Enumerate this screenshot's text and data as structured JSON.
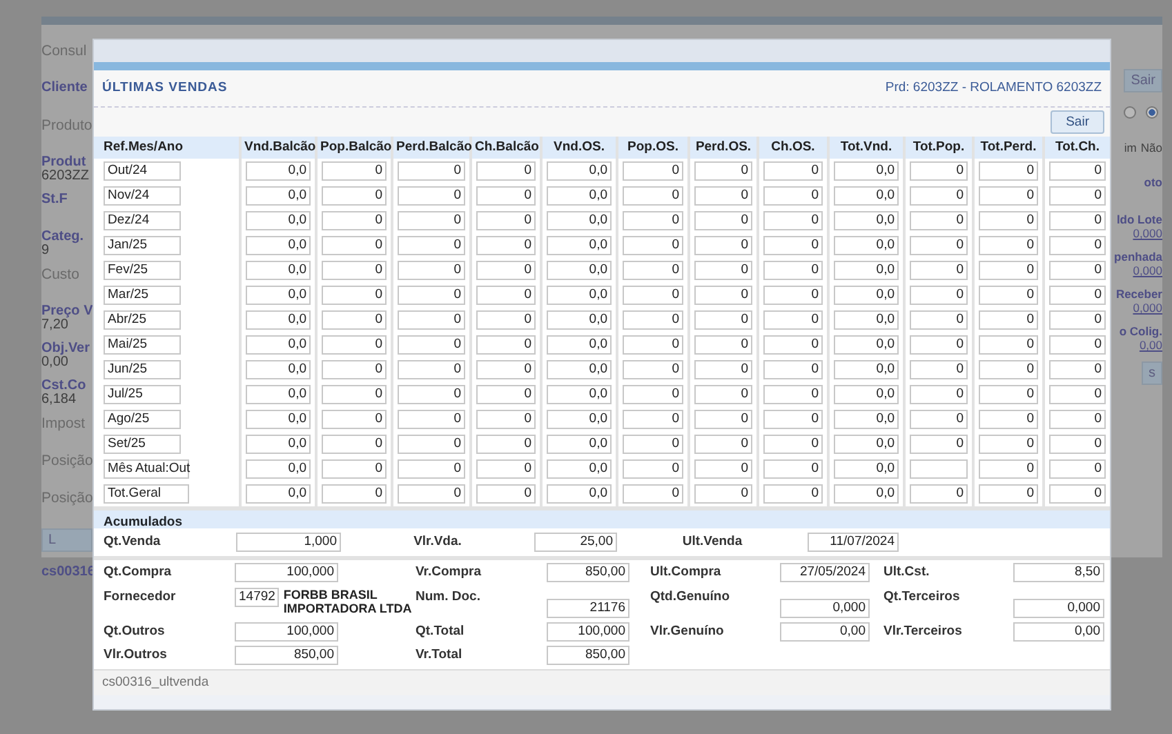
{
  "background": {
    "left": [
      {
        "kind": "heading",
        "text": "Consul"
      },
      {
        "kind": "label",
        "text": "Cliente"
      },
      {
        "kind": "heading",
        "text": "Produto"
      },
      {
        "kind": "pair",
        "text": "Produt",
        "value": "6203ZZ"
      },
      {
        "kind": "label",
        "text": "St.F"
      },
      {
        "kind": "pair",
        "text": "Categ.",
        "value": "9"
      },
      {
        "kind": "heading",
        "text": "Custo"
      },
      {
        "kind": "pair",
        "text": "Preço V",
        "value": "7,20"
      },
      {
        "kind": "pair",
        "text": "Obj.Ver",
        "value": "0,00"
      },
      {
        "kind": "pair",
        "text": "Cst.Co",
        "value": "6,184"
      },
      {
        "kind": "heading",
        "text": "Impost"
      },
      {
        "kind": "heading",
        "text": "Posição"
      },
      {
        "kind": "heading",
        "text": "Posição"
      },
      {
        "kind": "button",
        "text": "L"
      },
      {
        "kind": "label",
        "text": "cs00316"
      }
    ],
    "right": [
      {
        "kind": "button",
        "text": "Sair"
      },
      {
        "kind": "radio",
        "options": [
          {
            "label": "im",
            "selected": false
          },
          {
            "label": "Não",
            "selected": true
          }
        ]
      },
      {
        "kind": "label",
        "text": "oto"
      },
      {
        "kind": "pair",
        "text": "ldo Lote",
        "value": "0,000"
      },
      {
        "kind": "pair",
        "text": "penhada",
        "value": "0,000"
      },
      {
        "kind": "pair",
        "text": "Receber",
        "value": "0,000"
      },
      {
        "kind": "pair",
        "text": "o Colig.",
        "value": "0,00"
      },
      {
        "kind": "button",
        "text": "s"
      }
    ]
  },
  "dialog": {
    "title": "ÚLTIMAS VENDAS",
    "product": "Prd: 6203ZZ - ROLAMENTO 6203ZZ",
    "close_button": "Sair",
    "table": {
      "columns": [
        "Ref.Mes/Ano",
        "Vnd.Balcão",
        "Pop.Balcão",
        "Perd.Balcão",
        "Ch.Balcão",
        "Vnd.OS.",
        "Pop.OS.",
        "Perd.OS.",
        "Ch.OS.",
        "Tot.Vnd.",
        "Tot.Pop.",
        "Tot.Perd.",
        "Tot.Ch."
      ],
      "rows": [
        {
          "cells": [
            {
              "value": "Out/24"
            },
            {
              "value": "0,0"
            },
            {
              "value": "0"
            },
            {
              "value": "0"
            },
            {
              "value": "0"
            },
            {
              "value": "0,0"
            },
            {
              "value": "0"
            },
            {
              "value": "0"
            },
            {
              "value": "0"
            },
            {
              "value": "0,0"
            },
            {
              "value": "0"
            },
            {
              "value": "0"
            },
            {
              "value": "0"
            }
          ]
        },
        {
          "cells": [
            {
              "value": "Nov/24"
            },
            {
              "value": "0,0"
            },
            {
              "value": "0"
            },
            {
              "value": "0"
            },
            {
              "value": "0"
            },
            {
              "value": "0,0"
            },
            {
              "value": "0"
            },
            {
              "value": "0"
            },
            {
              "value": "0"
            },
            {
              "value": "0,0"
            },
            {
              "value": "0"
            },
            {
              "value": "0"
            },
            {
              "value": "0"
            }
          ]
        },
        {
          "cells": [
            {
              "value": "Dez/24"
            },
            {
              "value": "0,0"
            },
            {
              "value": "0"
            },
            {
              "value": "0"
            },
            {
              "value": "0"
            },
            {
              "value": "0,0"
            },
            {
              "value": "0"
            },
            {
              "value": "0"
            },
            {
              "value": "0"
            },
            {
              "value": "0,0"
            },
            {
              "value": "0"
            },
            {
              "value": "0"
            },
            {
              "value": "0"
            }
          ]
        },
        {
          "cells": [
            {
              "value": "Jan/25"
            },
            {
              "value": "0,0"
            },
            {
              "value": "0"
            },
            {
              "value": "0"
            },
            {
              "value": "0"
            },
            {
              "value": "0,0"
            },
            {
              "value": "0"
            },
            {
              "value": "0"
            },
            {
              "value": "0"
            },
            {
              "value": "0,0"
            },
            {
              "value": "0"
            },
            {
              "value": "0"
            },
            {
              "value": "0"
            }
          ]
        },
        {
          "cells": [
            {
              "value": "Fev/25"
            },
            {
              "value": "0,0"
            },
            {
              "value": "0"
            },
            {
              "value": "0"
            },
            {
              "value": "0"
            },
            {
              "value": "0,0"
            },
            {
              "value": "0"
            },
            {
              "value": "0"
            },
            {
              "value": "0"
            },
            {
              "value": "0,0"
            },
            {
              "value": "0"
            },
            {
              "value": "0"
            },
            {
              "value": "0"
            }
          ]
        },
        {
          "cells": [
            {
              "value": "Mar/25"
            },
            {
              "value": "0,0"
            },
            {
              "value": "0"
            },
            {
              "value": "0"
            },
            {
              "value": "0"
            },
            {
              "value": "0,0"
            },
            {
              "value": "0"
            },
            {
              "value": "0"
            },
            {
              "value": "0"
            },
            {
              "value": "0,0"
            },
            {
              "value": "0"
            },
            {
              "value": "0"
            },
            {
              "value": "0"
            }
          ]
        },
        {
          "cells": [
            {
              "value": "Abr/25"
            },
            {
              "value": "0,0"
            },
            {
              "value": "0"
            },
            {
              "value": "0"
            },
            {
              "value": "0"
            },
            {
              "value": "0,0"
            },
            {
              "value": "0"
            },
            {
              "value": "0"
            },
            {
              "value": "0"
            },
            {
              "value": "0,0"
            },
            {
              "value": "0"
            },
            {
              "value": "0"
            },
            {
              "value": "0"
            }
          ]
        },
        {
          "cells": [
            {
              "value": "Mai/25"
            },
            {
              "value": "0,0"
            },
            {
              "value": "0"
            },
            {
              "value": "0"
            },
            {
              "value": "0"
            },
            {
              "value": "0,0"
            },
            {
              "value": "0"
            },
            {
              "value": "0"
            },
            {
              "value": "0"
            },
            {
              "value": "0,0"
            },
            {
              "value": "0"
            },
            {
              "value": "0"
            },
            {
              "value": "0"
            }
          ]
        },
        {
          "cells": [
            {
              "value": "Jun/25"
            },
            {
              "value": "0,0"
            },
            {
              "value": "0"
            },
            {
              "value": "0"
            },
            {
              "value": "0"
            },
            {
              "value": "0,0"
            },
            {
              "value": "0"
            },
            {
              "value": "0"
            },
            {
              "value": "0"
            },
            {
              "value": "0,0"
            },
            {
              "value": "0"
            },
            {
              "value": "0"
            },
            {
              "value": "0"
            }
          ]
        },
        {
          "cells": [
            {
              "value": "Jul/25"
            },
            {
              "value": "0,0"
            },
            {
              "value": "0"
            },
            {
              "value": "0"
            },
            {
              "value": "0"
            },
            {
              "value": "0,0"
            },
            {
              "value": "0"
            },
            {
              "value": "0"
            },
            {
              "value": "0"
            },
            {
              "value": "0,0"
            },
            {
              "value": "0"
            },
            {
              "value": "0"
            },
            {
              "value": "0"
            }
          ]
        },
        {
          "cells": [
            {
              "value": "Ago/25"
            },
            {
              "value": "0,0"
            },
            {
              "value": "0"
            },
            {
              "value": "0"
            },
            {
              "value": "0"
            },
            {
              "value": "0,0"
            },
            {
              "value": "0"
            },
            {
              "value": "0"
            },
            {
              "value": "0"
            },
            {
              "value": "0,0"
            },
            {
              "value": "0"
            },
            {
              "value": "0"
            },
            {
              "value": "0"
            }
          ]
        },
        {
          "cells": [
            {
              "value": "Set/25"
            },
            {
              "value": "0,0"
            },
            {
              "value": "0"
            },
            {
              "value": "0"
            },
            {
              "value": "0"
            },
            {
              "value": "0,0"
            },
            {
              "value": "0"
            },
            {
              "value": "0"
            },
            {
              "value": "0"
            },
            {
              "value": "0,0"
            },
            {
              "value": "0"
            },
            {
              "value": "0"
            },
            {
              "value": "0"
            }
          ]
        },
        {
          "cells": [
            {
              "value": "Mês Atual:Out"
            },
            {
              "value": "0,0"
            },
            {
              "value": "0"
            },
            {
              "value": "0"
            },
            {
              "value": "0"
            },
            {
              "value": "0,0"
            },
            {
              "value": "0"
            },
            {
              "value": "0"
            },
            {
              "value": "0"
            },
            {
              "value": "0,0"
            },
            {},
            {
              "value": "0"
            },
            {
              "value": "0"
            }
          ]
        },
        {
          "cells": [
            {
              "value": "Tot.Geral"
            },
            {
              "value": "0,0"
            },
            {
              "value": "0"
            },
            {
              "value": "0"
            },
            {
              "value": "0"
            },
            {
              "value": "0,0"
            },
            {
              "value": "0"
            },
            {
              "value": "0"
            },
            {
              "value": "0"
            },
            {
              "value": "0,0"
            },
            {
              "value": "0"
            },
            {
              "value": "0"
            },
            {
              "value": "0"
            }
          ]
        }
      ]
    },
    "accumulated": {
      "title": "Acumulados",
      "summary": [
        {
          "label": "Qt.Venda",
          "value": "1,000"
        },
        {
          "label": "Vlr.Vda.",
          "value": "25,00"
        },
        {
          "label": "Ult.Venda",
          "value": "11/07/2024"
        }
      ],
      "rows": [
        [
          {
            "label": "Qt.Compra",
            "value": "100,000"
          },
          {
            "label": "Vr.Compra",
            "value": "850,00"
          },
          {
            "label": "Ult.Compra",
            "value": "27/05/2024"
          },
          {
            "label": "Ult.Cst.",
            "value": "8,50"
          }
        ],
        [
          {
            "label": "Fornecedor",
            "kind": "supplier",
            "value": "14792",
            "name": "FORBB BRASIL IMPORTADORA LTDA"
          },
          {
            "label": "Num. Doc.",
            "value": "21176"
          },
          {
            "label": "Qtd.Genuíno",
            "value": "0,000"
          },
          {
            "label": "Qt.Terceiros",
            "value": "0,000"
          }
        ],
        [
          {
            "label": "Qt.Outros",
            "value": "100,000"
          },
          {
            "label": "Qt.Total",
            "value": "100,000"
          },
          {
            "label": "Vlr.Genuíno",
            "value": "0,00"
          },
          {
            "label": "Vlr.Terceiros",
            "value": "0,00"
          }
        ],
        [
          {
            "label": "Vlr.Outros",
            "value": "850,00"
          },
          {
            "label": "Vr.Total",
            "value": "850,00"
          }
        ]
      ]
    },
    "footer": "cs00316_ultvenda"
  }
}
